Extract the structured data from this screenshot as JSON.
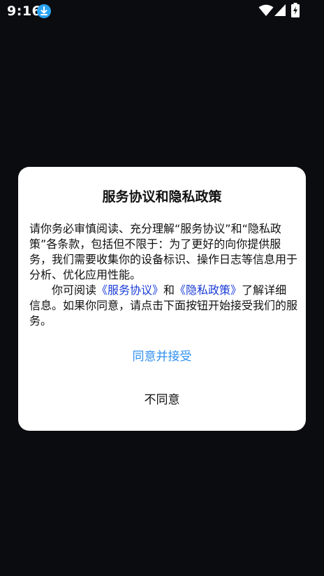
{
  "status_bar": {
    "time": "9:16",
    "icons": [
      "download-icon",
      "wifi-icon",
      "signal-icon",
      "battery-charging-icon"
    ]
  },
  "dialog": {
    "title": "服务协议和隐私政策",
    "paragraph1": "请你务必审慎阅读、充分理解“服务协议”和“隐私政策”各条款，包括但不限于：为了更好的向你提供服务，我们需要收集你的设备标识、操作日志等信息用于分析、优化应用性能。",
    "paragraph2": {
      "prefix": "你可阅读",
      "link1": "《服务协议》",
      "middle": "和",
      "link2": "《隐私政策》",
      "suffix": "了解详细信息。如果你同意，请点击下面按钮开始接受我们的服务。"
    },
    "agree_label": "同意并接受",
    "disagree_label": "不同意"
  },
  "colors": {
    "background": "#0b0c10",
    "dialog": "#ffffff",
    "accent": "#2f8ff0",
    "link": "#1a3bd6",
    "download_badge": "#29a3f2"
  }
}
